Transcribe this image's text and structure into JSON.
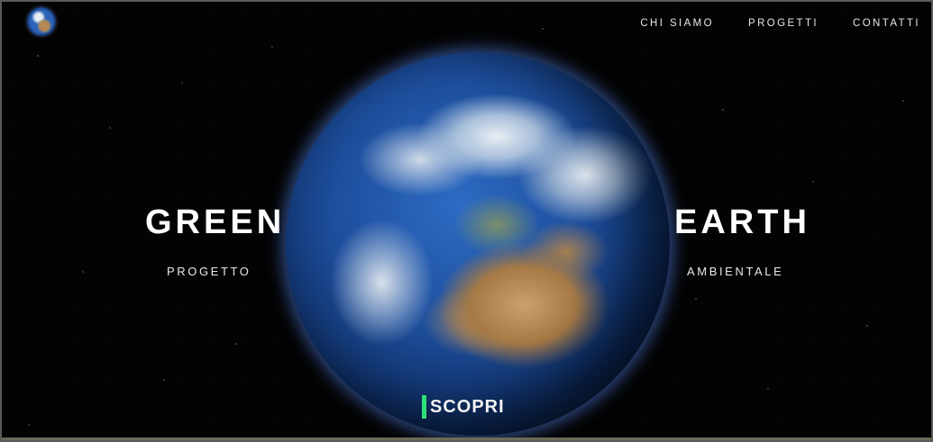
{
  "nav": {
    "items": [
      "CHI SIAMO",
      "PROGETTI",
      "CONTATTI"
    ]
  },
  "hero": {
    "title_left": "GREEN",
    "title_right": "EARTH",
    "subtitle_left": "PROGETTO",
    "subtitle_right": "AMBIENTALE",
    "cta_label": "SCOPRI"
  },
  "colors": {
    "background": "#030303",
    "text": "#ffffff",
    "accent": "#2ee07a"
  },
  "icons": {
    "logo": "earth-globe-icon"
  }
}
